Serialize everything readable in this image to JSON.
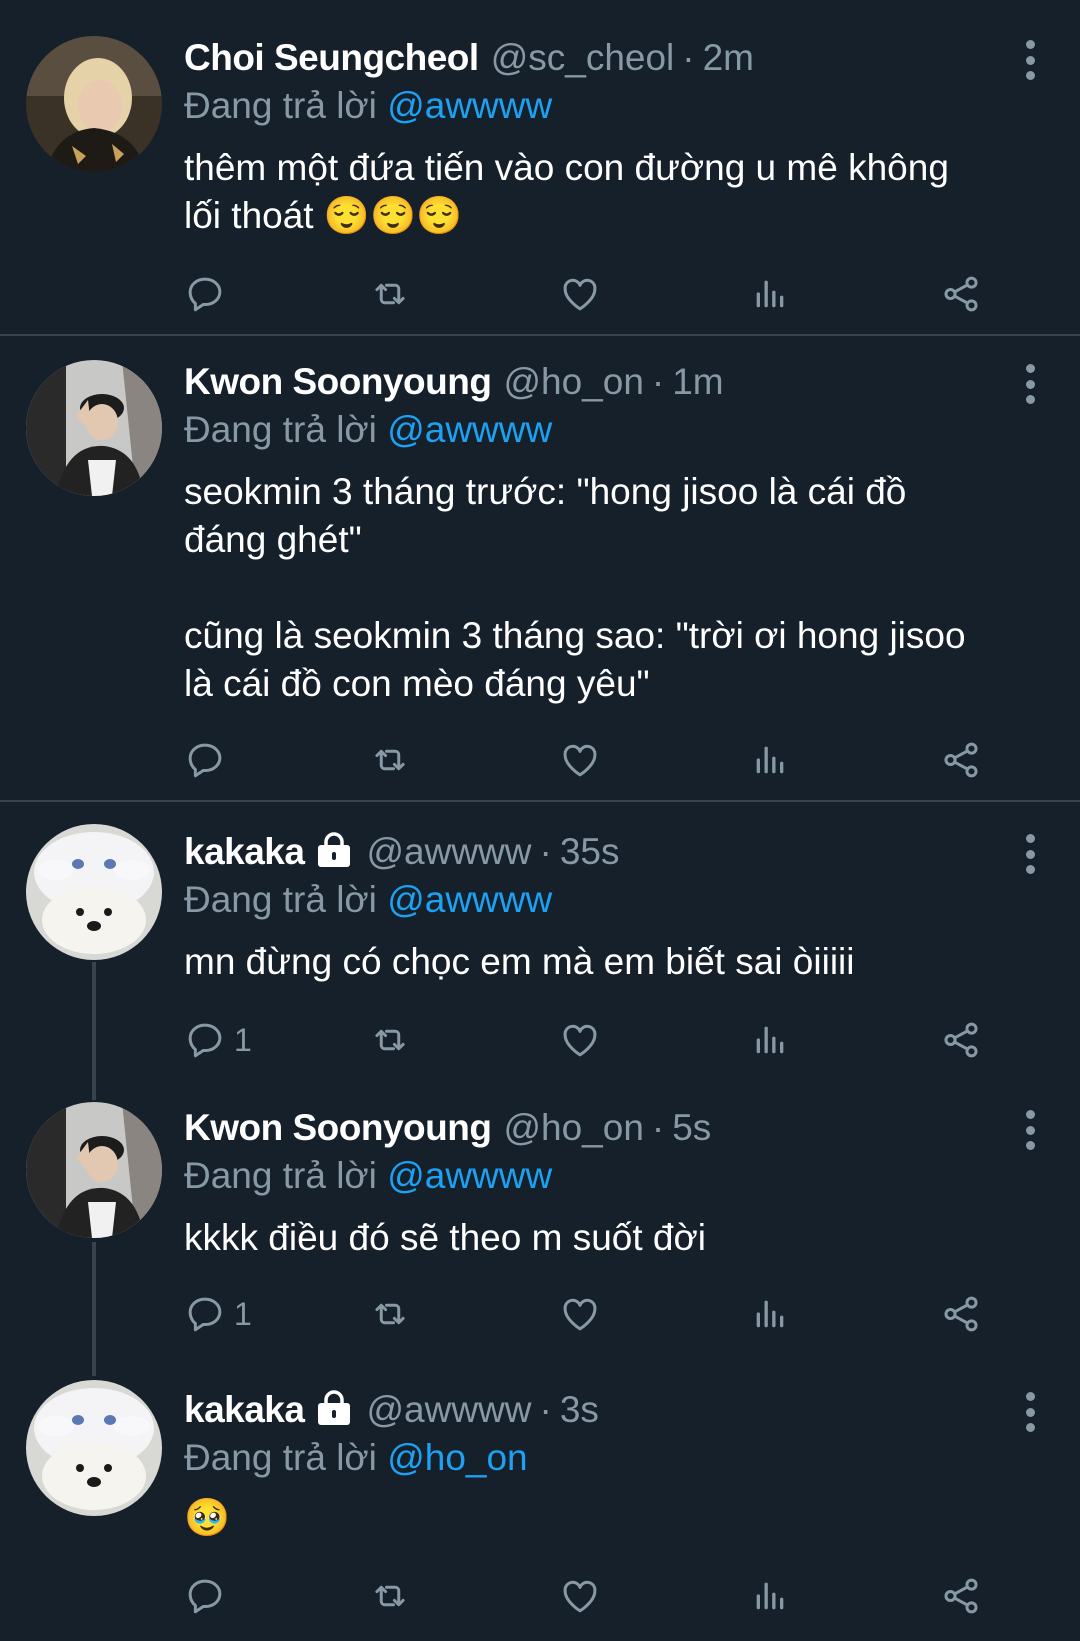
{
  "tweets": [
    {
      "name": "Choi Seungcheol",
      "locked": false,
      "handle": "@sc_cheol",
      "dot": "·",
      "time": "2m",
      "reply_prefix": "Đang trả lời",
      "reply_to": "@awwww",
      "text": "thêm một đứa tiến vào con đường u mê không\nlối thoát 😌😌😌",
      "reply_count": "",
      "avatar": "blond-person-avatar"
    },
    {
      "name": "Kwon Soonyoung",
      "locked": false,
      "handle": "@ho_on",
      "dot": "·",
      "time": "1m",
      "reply_prefix": "Đang trả lời",
      "reply_to": "@awwww",
      "text": "seokmin 3 tháng trước: \"hong jisoo là cái đồ\nđáng ghét\"\n\ncũng là seokmin 3 tháng sao: \"trời ơi hong jisoo\nlà cái đồ con mèo đáng yêu\"",
      "reply_count": "",
      "avatar": "capped-person-avatar"
    },
    {
      "name": "kakaka",
      "locked": true,
      "handle": "@awwww",
      "dot": "·",
      "time": "35s",
      "reply_prefix": "Đang trả lời",
      "reply_to": "@awwww",
      "text": "mn đừng có chọc em mà em biết sai òiiiii",
      "reply_count": "1",
      "avatar": "white-dog-avatar"
    },
    {
      "name": "Kwon Soonyoung",
      "locked": false,
      "handle": "@ho_on",
      "dot": "·",
      "time": "5s",
      "reply_prefix": "Đang trả lời",
      "reply_to": "@awwww",
      "text": "kkkk điều đó sẽ theo m suốt đời",
      "reply_count": "1",
      "avatar": "capped-person-avatar"
    },
    {
      "name": "kakaka",
      "locked": true,
      "handle": "@awwww",
      "dot": "·",
      "time": "3s",
      "reply_prefix": "Đang trả lời",
      "reply_to": "@ho_on",
      "text": "🥹",
      "reply_count": "",
      "avatar": "white-dog-avatar"
    }
  ],
  "icons": {
    "reply": "reply-icon",
    "retweet": "retweet-icon",
    "like": "heart-icon",
    "analytics": "analytics-icon",
    "share": "share-icon",
    "more": "more-vertical-icon",
    "lock": "lock-icon"
  },
  "colors": {
    "background": "#15202b",
    "text": "#ffffff",
    "muted": "#8899a6",
    "mention": "#1da1f2",
    "divider": "#38444d"
  }
}
